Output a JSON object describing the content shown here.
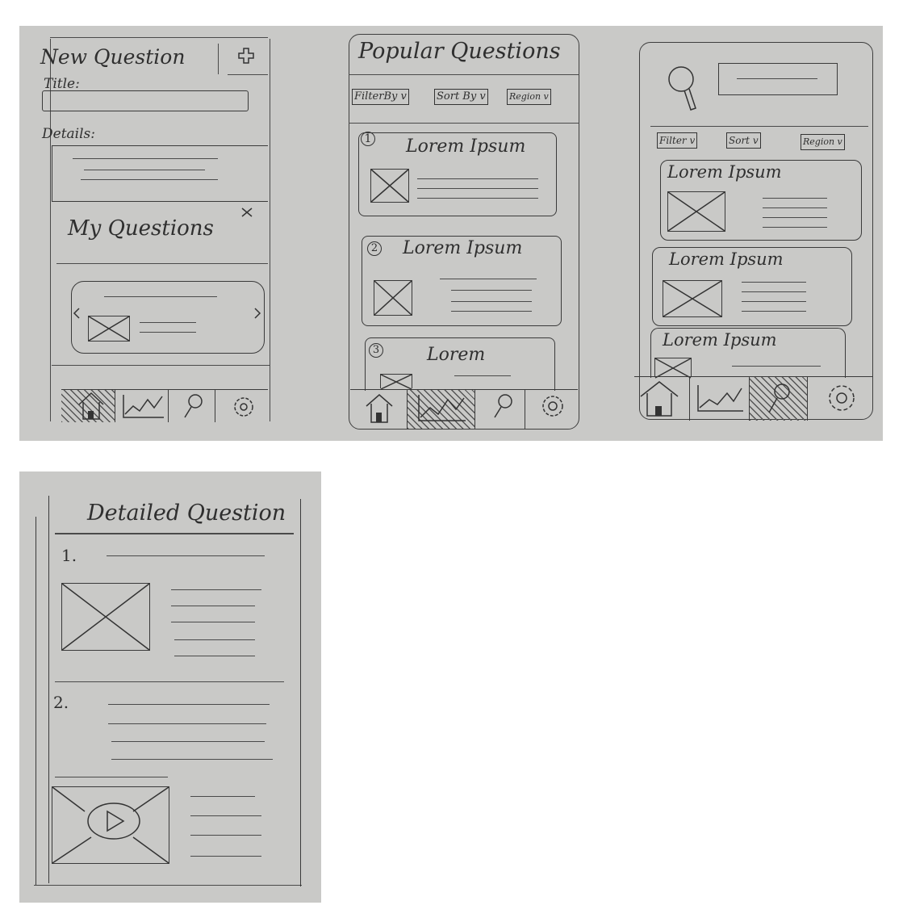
{
  "new_question": {
    "title": "New Question",
    "title_label": "Title:",
    "details_label": "Details:",
    "my_questions": "My Questions"
  },
  "popular": {
    "title": "Popular Questions",
    "filters": [
      "FilterBy v",
      "Sort By v",
      "Region v"
    ],
    "cards": [
      {
        "number": "1",
        "title": "Lorem Ipsum"
      },
      {
        "number": "2",
        "title": "Lorem Ipsum"
      },
      {
        "number": "3",
        "title": "Lorem"
      }
    ]
  },
  "search": {
    "filters": [
      "Filter v",
      "Sort v",
      "Region v"
    ],
    "cards": [
      {
        "title": "Lorem Ipsum"
      },
      {
        "title": "Lorem Ipsum"
      },
      {
        "title": "Lorem Ipsum"
      }
    ]
  },
  "detailed": {
    "title": "Detailed Question",
    "item1": "1.",
    "item2": "2."
  },
  "nav_icons": [
    "home-icon",
    "chart-icon",
    "search-icon",
    "settings-icon"
  ]
}
